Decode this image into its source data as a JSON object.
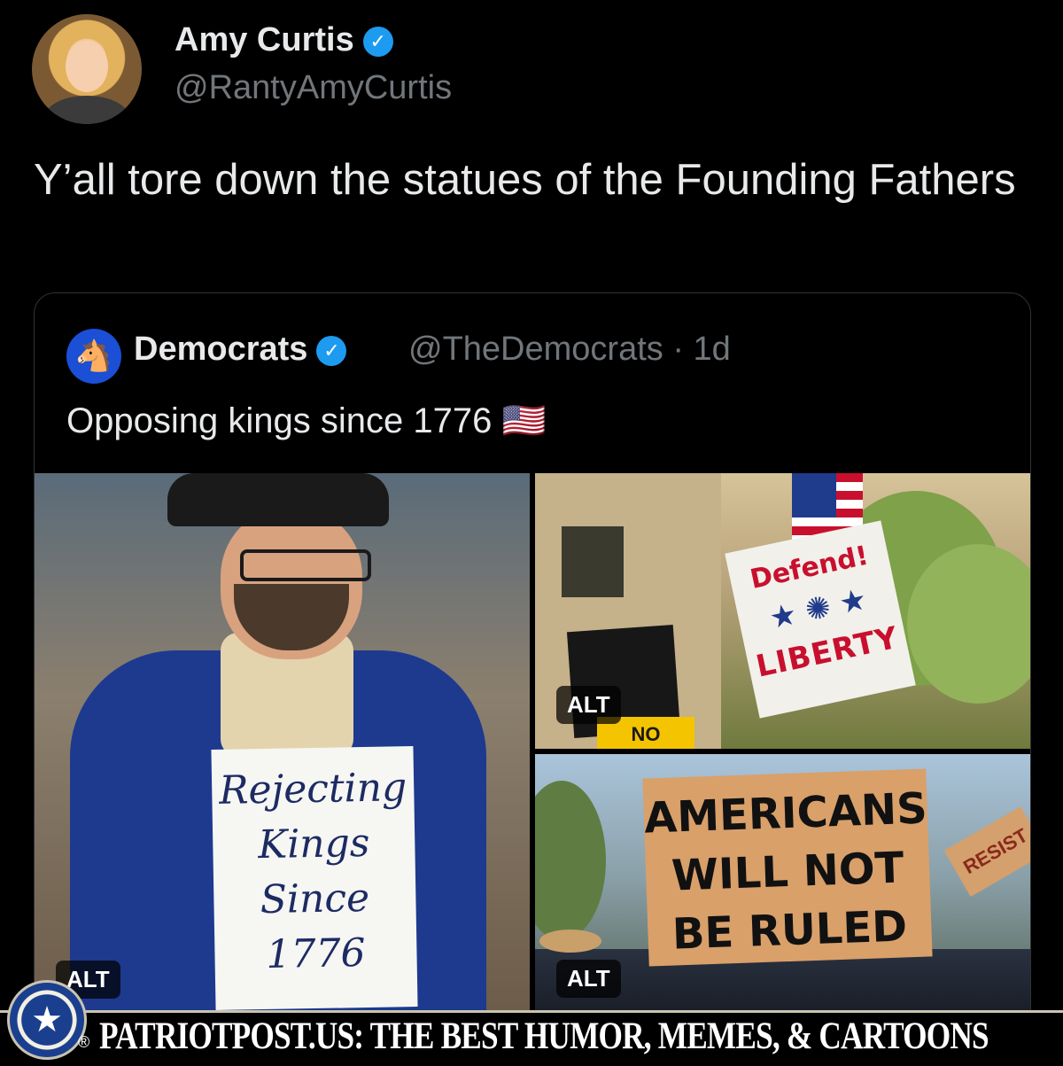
{
  "post": {
    "author_name": "Amy Curtis",
    "author_handle": "@RantyAmyCurtis",
    "text": "Y’all tore down the statues of the Founding Fathers"
  },
  "quote": {
    "author_name": "Democrats",
    "author_handle": "@TheDemocrats",
    "age": "· 1d",
    "text": "Opposing kings since 1776",
    "flag_emoji": "🇺🇸",
    "media": [
      {
        "alt_label": "ALT",
        "sign_text": "Rejecting Kings Since 1776"
      },
      {
        "alt_label": "ALT",
        "sign_line1": "Defend!",
        "sign_line2": "LIBERTY",
        "small_sign": "NO"
      },
      {
        "alt_label": "ALT",
        "sign_text": "AMERICANS WILL NOT BE RULED",
        "side_sign": "RESIST"
      }
    ]
  },
  "icons": {
    "verified": "verified-badge-icon",
    "democrats_logo": "donkey-icon"
  },
  "colors": {
    "background": "#000000",
    "text_primary": "#e7e9ea",
    "text_secondary": "#71767b",
    "verified_blue": "#1d9bf0",
    "border": "#2f3336"
  },
  "banner": {
    "registered_mark": "®",
    "text": "PATRIOTPOST.US: THE BEST HUMOR, MEMES, & CARTOONS"
  }
}
